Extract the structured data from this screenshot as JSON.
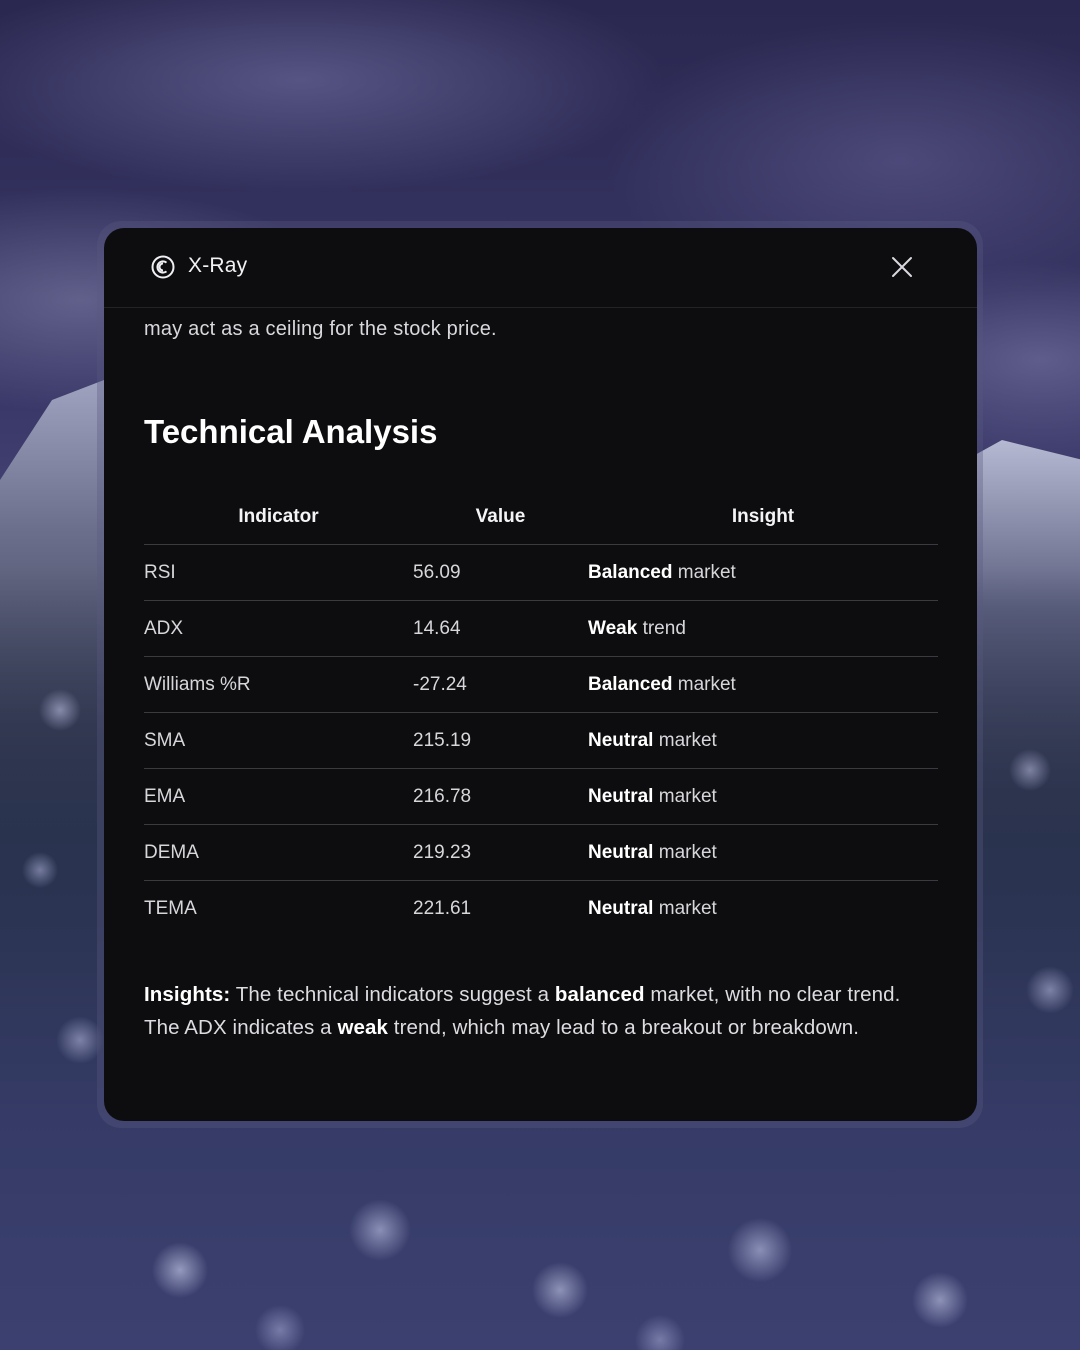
{
  "app": {
    "title": "X-Ray"
  },
  "lead_text": "may act as a ceiling for the stock price.",
  "section_title": "Technical Analysis",
  "table": {
    "headers": [
      "Indicator",
      "Value",
      "Insight"
    ],
    "rows": [
      {
        "indicator": "RSI",
        "value": "56.09",
        "insight_strong": "Balanced",
        "insight_rest": " market"
      },
      {
        "indicator": "ADX",
        "value": "14.64",
        "insight_strong": "Weak",
        "insight_rest": " trend"
      },
      {
        "indicator": "Williams %R",
        "value": "-27.24",
        "insight_strong": "Balanced",
        "insight_rest": " market"
      },
      {
        "indicator": "SMA",
        "value": "215.19",
        "insight_strong": "Neutral",
        "insight_rest": " market"
      },
      {
        "indicator": "EMA",
        "value": "216.78",
        "insight_strong": "Neutral",
        "insight_rest": " market"
      },
      {
        "indicator": "DEMA",
        "value": "219.23",
        "insight_strong": "Neutral",
        "insight_rest": " market"
      },
      {
        "indicator": "TEMA",
        "value": "221.61",
        "insight_strong": "Neutral",
        "insight_rest": " market"
      }
    ]
  },
  "summary": {
    "label": "Insights:",
    "part1": " The technical indicators suggest a ",
    "strong1": "balanced",
    "part2": " market, with no clear trend. The ADX indicates a ",
    "strong2": "weak",
    "part3": " trend, which may lead to a breakout or breakdown."
  },
  "icons": {
    "logo": "xray-logo-icon",
    "close": "close-icon"
  },
  "colors": {
    "panel_bg": "#0d0d0f",
    "text": "#e6e6ea",
    "divider": "#3a3a40"
  }
}
